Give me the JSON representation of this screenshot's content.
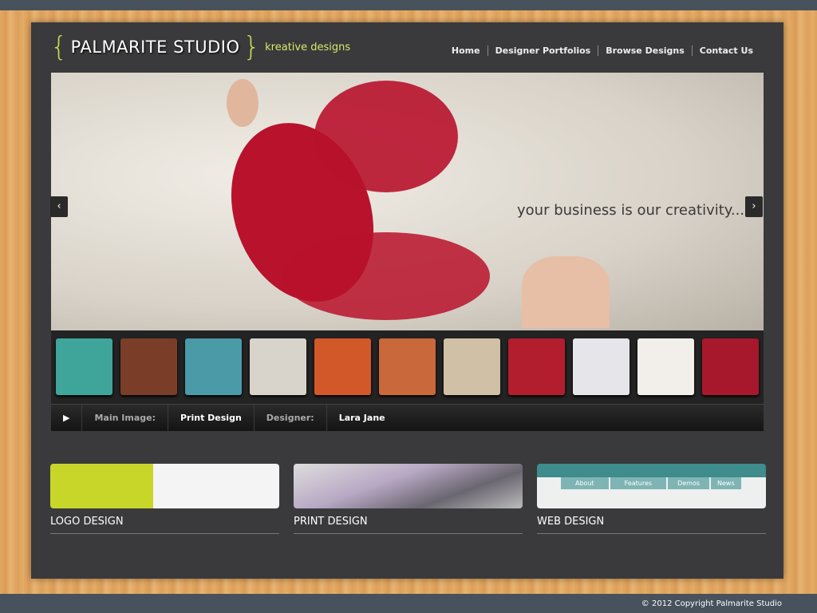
{
  "header": {
    "logo_name": "PALMARITE STUDIO",
    "logo_open": "{",
    "logo_close": "}",
    "tagline": "kreative designs",
    "nav": [
      "Home",
      "Designer Portfolios",
      "Browse Designs",
      "Contact Us"
    ]
  },
  "slider": {
    "slogan": "your business is our creativity...",
    "prev": "‹",
    "next": "›",
    "thumbnails": [
      "#3fa59a",
      "#7a3e28",
      "#4a9aa8",
      "#d8d4cc",
      "#d2582a",
      "#c9683a",
      "#cfc0a6",
      "#b21e2e",
      "#e6e6ea",
      "#f2efea",
      "#a8182c"
    ]
  },
  "infobar": {
    "play": "▶",
    "main_label": "Main Image:",
    "main_value": "Print Design",
    "designer_label": "Designer:",
    "designer_value": "Lara Jane"
  },
  "categories": [
    {
      "title": "LOGO DESIGN"
    },
    {
      "title": "PRINT DESIGN"
    },
    {
      "title": "WEB DESIGN",
      "tabs": [
        "About",
        "Features",
        "Demos",
        "News"
      ]
    }
  ],
  "footer": {
    "copyright": "© 2012 Copyright  Palmarite Studio"
  }
}
